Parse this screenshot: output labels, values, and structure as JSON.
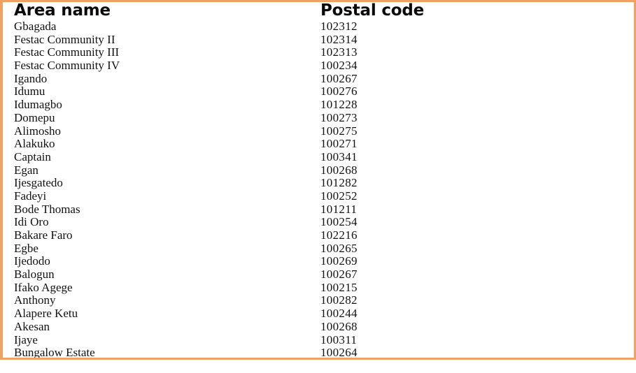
{
  "table": {
    "columns": [
      {
        "key": "area_name",
        "label": "Area name"
      },
      {
        "key": "postal_code",
        "label": "Postal code"
      }
    ],
    "rows": [
      {
        "area_name": "Gbagada",
        "postal_code": "102312"
      },
      {
        "area_name": "Festac Community II",
        "postal_code": "102314"
      },
      {
        "area_name": "Festac Community III",
        "postal_code": "102313"
      },
      {
        "area_name": "Festac Community IV",
        "postal_code": "100234"
      },
      {
        "area_name": "Igando",
        "postal_code": "100267"
      },
      {
        "area_name": "Idumu",
        "postal_code": "100276"
      },
      {
        "area_name": "Idumagbo",
        "postal_code": "101228"
      },
      {
        "area_name": "Domepu",
        "postal_code": "100273"
      },
      {
        "area_name": "Alimosho",
        "postal_code": "100275"
      },
      {
        "area_name": "Alakuko",
        "postal_code": "100271"
      },
      {
        "area_name": "Captain",
        "postal_code": "100341"
      },
      {
        "area_name": "Egan",
        "postal_code": "100268"
      },
      {
        "area_name": "Ijesgatedo",
        "postal_code": "101282"
      },
      {
        "area_name": "Fadeyi",
        "postal_code": "100252"
      },
      {
        "area_name": "Bode Thomas",
        "postal_code": "101211"
      },
      {
        "area_name": "Idi Oro",
        "postal_code": "100254"
      },
      {
        "area_name": "Bakare Faro",
        "postal_code": "102216"
      },
      {
        "area_name": "Egbe",
        "postal_code": "100265"
      },
      {
        "area_name": "Ijedodo",
        "postal_code": "100269"
      },
      {
        "area_name": "Balogun",
        "postal_code": "100267"
      },
      {
        "area_name": "Ifako Agege",
        "postal_code": "100215"
      },
      {
        "area_name": "Anthony",
        "postal_code": "100282"
      },
      {
        "area_name": "Alapere Ketu",
        "postal_code": "100244"
      },
      {
        "area_name": "Akesan",
        "postal_code": "100268"
      },
      {
        "area_name": "Ijaye",
        "postal_code": "100311"
      },
      {
        "area_name": "Bungalow Estate",
        "postal_code": "100264"
      }
    ]
  },
  "style": {
    "frame_border_color": "#f0a265",
    "text_color": "#111111",
    "background_color": "#ffffff"
  }
}
